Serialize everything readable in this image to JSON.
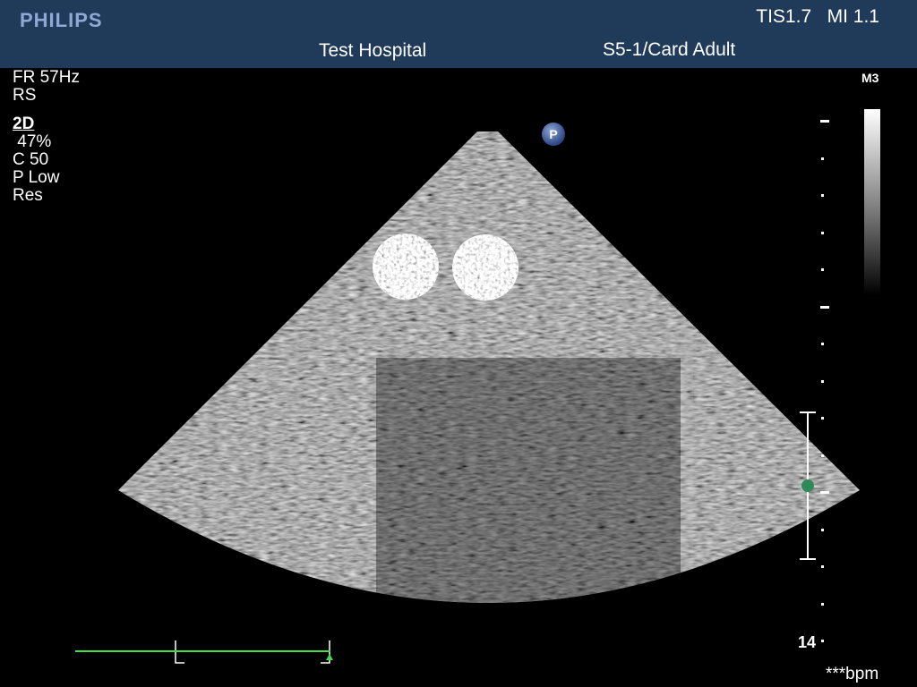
{
  "header": {
    "brand": "PHILIPS",
    "safety": "TIS1.7   MI 1.1",
    "hospital": "Test Hospital",
    "probe_preset": "S5-1/Card Adult"
  },
  "params": {
    "frame_rate": "FR 57Hz",
    "rs": "RS",
    "mode": "2D",
    "gain": " 47%",
    "compression": "C 50",
    "power": "P Low",
    "resolution": "Res"
  },
  "map": {
    "label": "M3"
  },
  "depth": {
    "max_label": "14"
  },
  "ecg": {
    "heart_rate": "***bpm",
    "line_color": "#3ee047"
  },
  "orientation_marker": {
    "label": "P"
  },
  "colors": {
    "header_bg": "#203a59",
    "brand": "#8fa9d6",
    "focus_marker": "#2e8b57"
  }
}
